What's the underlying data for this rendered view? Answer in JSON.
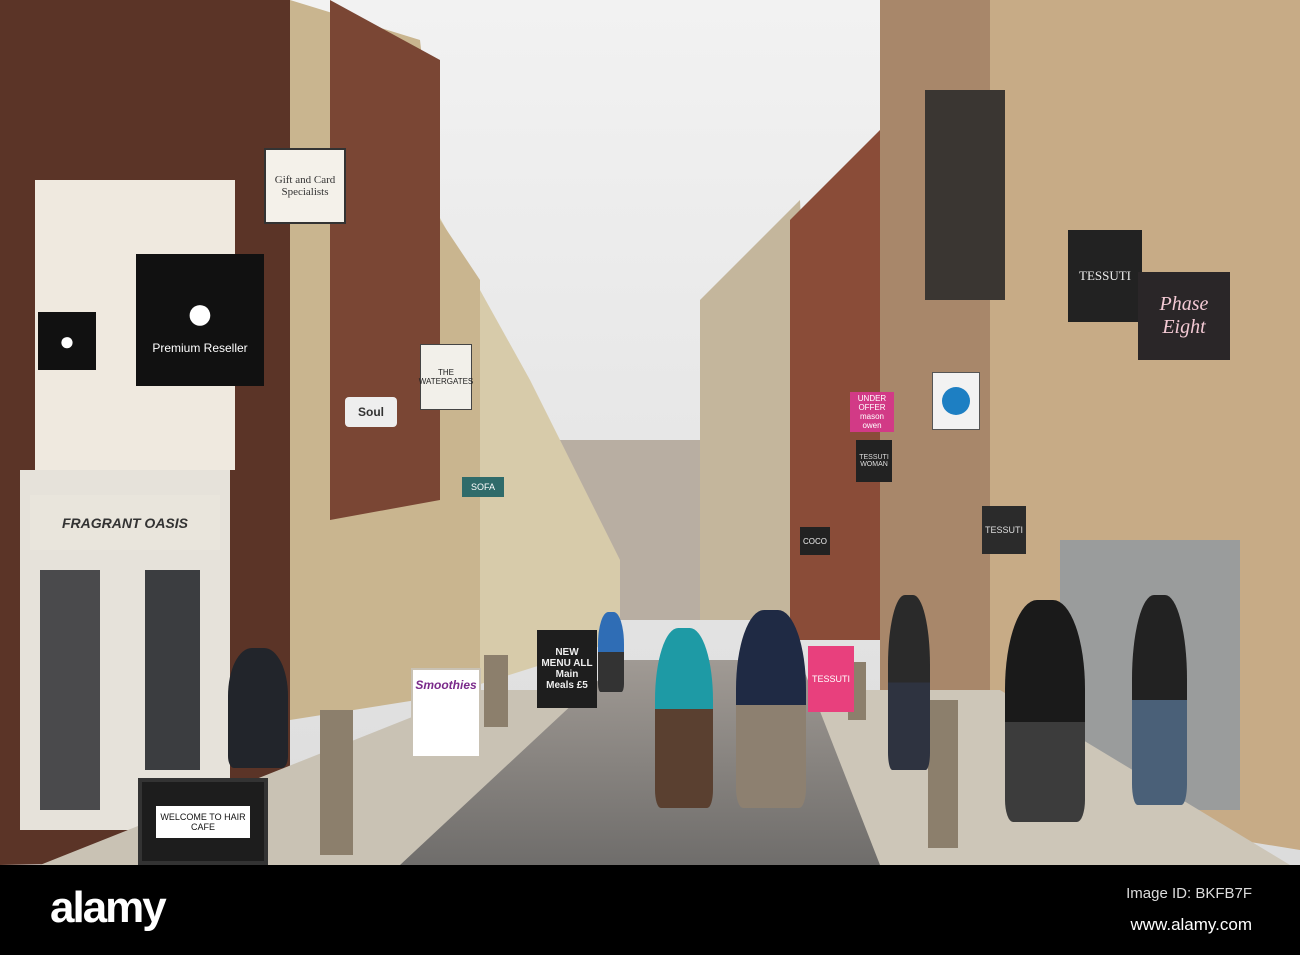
{
  "photo": {
    "subject": "pedestrian shopping street",
    "signs": {
      "gift_card": "Gift and Card Specialists",
      "apple_reseller": "Premium Reseller",
      "watergates": "THE WATERGATES",
      "soul": "Soul",
      "fragrant_oasis": "FRAGRANT OASIS",
      "sofa": "SOFA",
      "tessuti_hanging": "TESSUTI",
      "phase_eight": "Phase Eight",
      "tessuti_front": "TESSUTI",
      "under_offer": "UNDER OFFER",
      "mason_owen": "mason owen",
      "tessuti_woman": "TESSUTI WOMAN",
      "coco": "COCO",
      "smoothies": "Smoothies",
      "menu_board": "NEW MENU ALL Main Meals £5",
      "hair_cafe": "WELCOME TO HAIR CAFE",
      "tessuti_aboard": "TESSUTI"
    }
  },
  "colors": {
    "sky": "#ececec",
    "brick": "#6e3b2c",
    "stone": "#cbbd9e",
    "cobble": "#8a8a88"
  },
  "watermark": {
    "logo": "alamy",
    "image_id": "Image ID: BKFB7F",
    "url": "www.alamy.com"
  }
}
